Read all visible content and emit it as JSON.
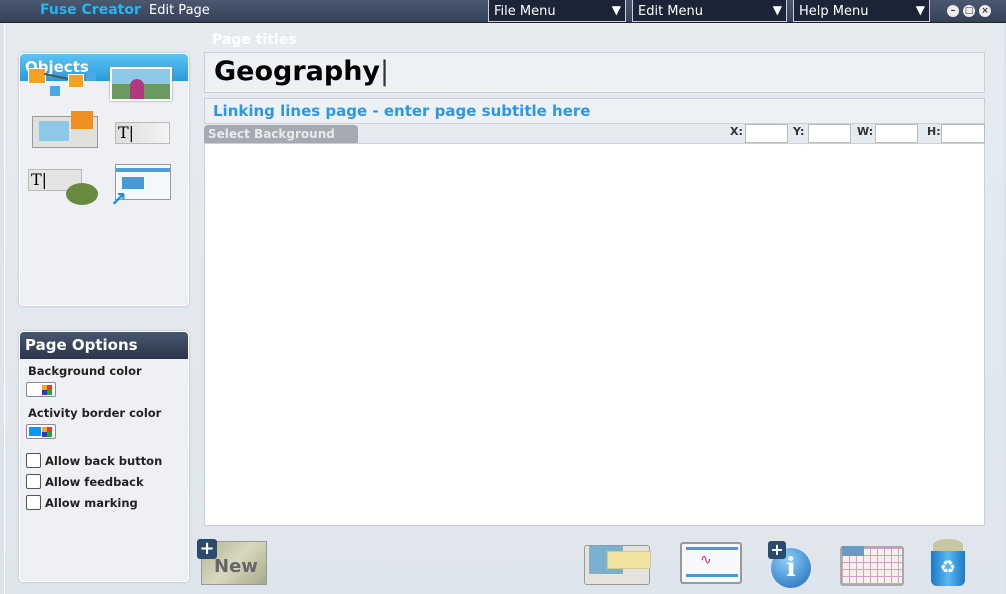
{
  "titlebar": {
    "app_name": "Fuse Creator",
    "subtitle": "Edit Page",
    "menus": [
      {
        "label": "File Menu"
      },
      {
        "label": "Edit Menu"
      },
      {
        "label": "Help Menu"
      }
    ],
    "window_buttons": [
      "minimize",
      "maximize",
      "close"
    ]
  },
  "objects": {
    "title": "Objects",
    "items": [
      "linking-lines-icon",
      "image-hotspot-icon",
      "image-card-icon",
      "text-field-icon",
      "text-click-icon",
      "slide-link-icon"
    ]
  },
  "page_options": {
    "title": "Page Options",
    "background_color_label": "Background color",
    "border_color_label": "Activity border color",
    "border_color": "#0099ff",
    "checkboxes": [
      {
        "label": "Allow back button",
        "checked": false
      },
      {
        "label": "Allow feedback",
        "checked": false
      },
      {
        "label": "Allow marking",
        "checked": false
      }
    ]
  },
  "editor": {
    "page_titles_label": "Page titles",
    "title_value": "Geography",
    "subtitle_value": "Linking lines page - enter page subtitle here",
    "select_background": "Select Background",
    "coords": {
      "x_label": "X:",
      "y_label": "Y:",
      "w_label": "W:",
      "h_label": "H:"
    }
  },
  "bottom": {
    "new_label": "New",
    "tools": [
      "layout-icon",
      "slide-preview-icon",
      "add-info-icon",
      "grid-icon",
      "recycle-bin-icon"
    ]
  }
}
